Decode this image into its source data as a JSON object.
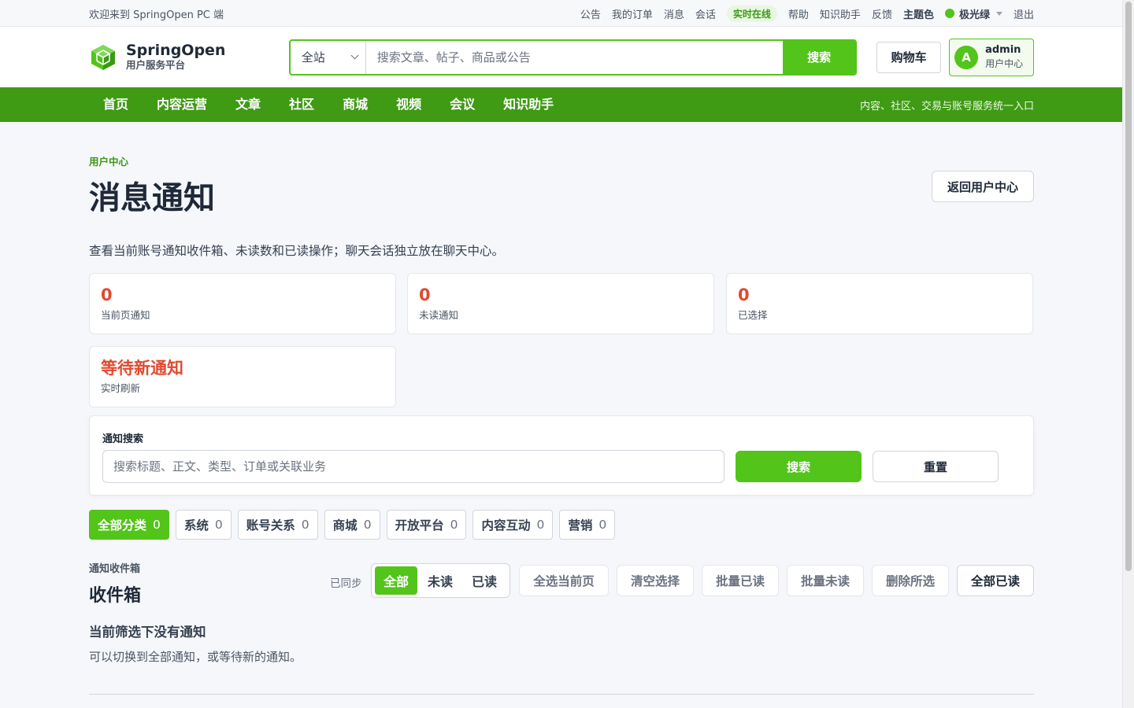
{
  "topbar": {
    "welcome": "欢迎来到 SpringOpen PC 端",
    "links": {
      "announcements": "公告",
      "orders": "我的订单",
      "messages": "消息",
      "chat": "会话",
      "online": "实时在线",
      "help": "帮助",
      "assistant": "知识助手",
      "feedback": "反馈",
      "theme_label": "主题色",
      "theme_value": "极光绿",
      "logout": "退出"
    }
  },
  "header": {
    "logo_title": "SpringOpen",
    "logo_subtitle": "用户服务平台",
    "search_scope": "全站",
    "search_placeholder": "搜索文章、帖子、商品或公告",
    "search_button": "搜索",
    "cart_button": "购物车",
    "user_avatar_letter": "A",
    "user_name": "admin",
    "user_center": "用户中心"
  },
  "nav": {
    "items": [
      "首页",
      "内容运营",
      "文章",
      "社区",
      "商城",
      "视频",
      "会议",
      "知识助手"
    ],
    "tagline": "内容、社区、交易与账号服务统一入口"
  },
  "page": {
    "breadcrumb": "用户中心",
    "title": "消息通知",
    "back_button": "返回用户中心",
    "description": "查看当前账号通知收件箱、未读数和已读操作；聊天会话独立放在聊天中心。"
  },
  "stats": [
    {
      "value": "0",
      "label": "当前页通知"
    },
    {
      "value": "0",
      "label": "未读通知"
    },
    {
      "value": "0",
      "label": "已选择"
    },
    {
      "value": "等待新通知",
      "label": "实时刷新"
    }
  ],
  "filter": {
    "label": "通知搜索",
    "placeholder": "搜索标题、正文、类型、订单或关联业务",
    "search_button": "搜索",
    "reset_button": "重置"
  },
  "categories": [
    {
      "label": "全部分类",
      "count": "0"
    },
    {
      "label": "系统",
      "count": "0"
    },
    {
      "label": "账号关系",
      "count": "0"
    },
    {
      "label": "商城",
      "count": "0"
    },
    {
      "label": "开放平台",
      "count": "0"
    },
    {
      "label": "内容互动",
      "count": "0"
    },
    {
      "label": "营销",
      "count": "0"
    }
  ],
  "inbox": {
    "eyebrow": "通知收件箱",
    "title": "收件箱",
    "sync_status": "已同步",
    "segments": [
      "全部",
      "未读",
      "已读"
    ],
    "actions": {
      "select_page": "全选当前页",
      "clear_selection": "清空选择",
      "batch_read": "批量已读",
      "batch_unread": "批量未读",
      "delete_selected": "删除所选",
      "mark_all_read": "全部已读"
    },
    "empty_title": "当前筛选下没有通知",
    "empty_desc": "可以切换到全部通知，或等待新的通知。"
  },
  "colors": {
    "brand": "#52c41a",
    "nav_bg": "#3f9a14",
    "stat_value": "#e04a2f"
  }
}
